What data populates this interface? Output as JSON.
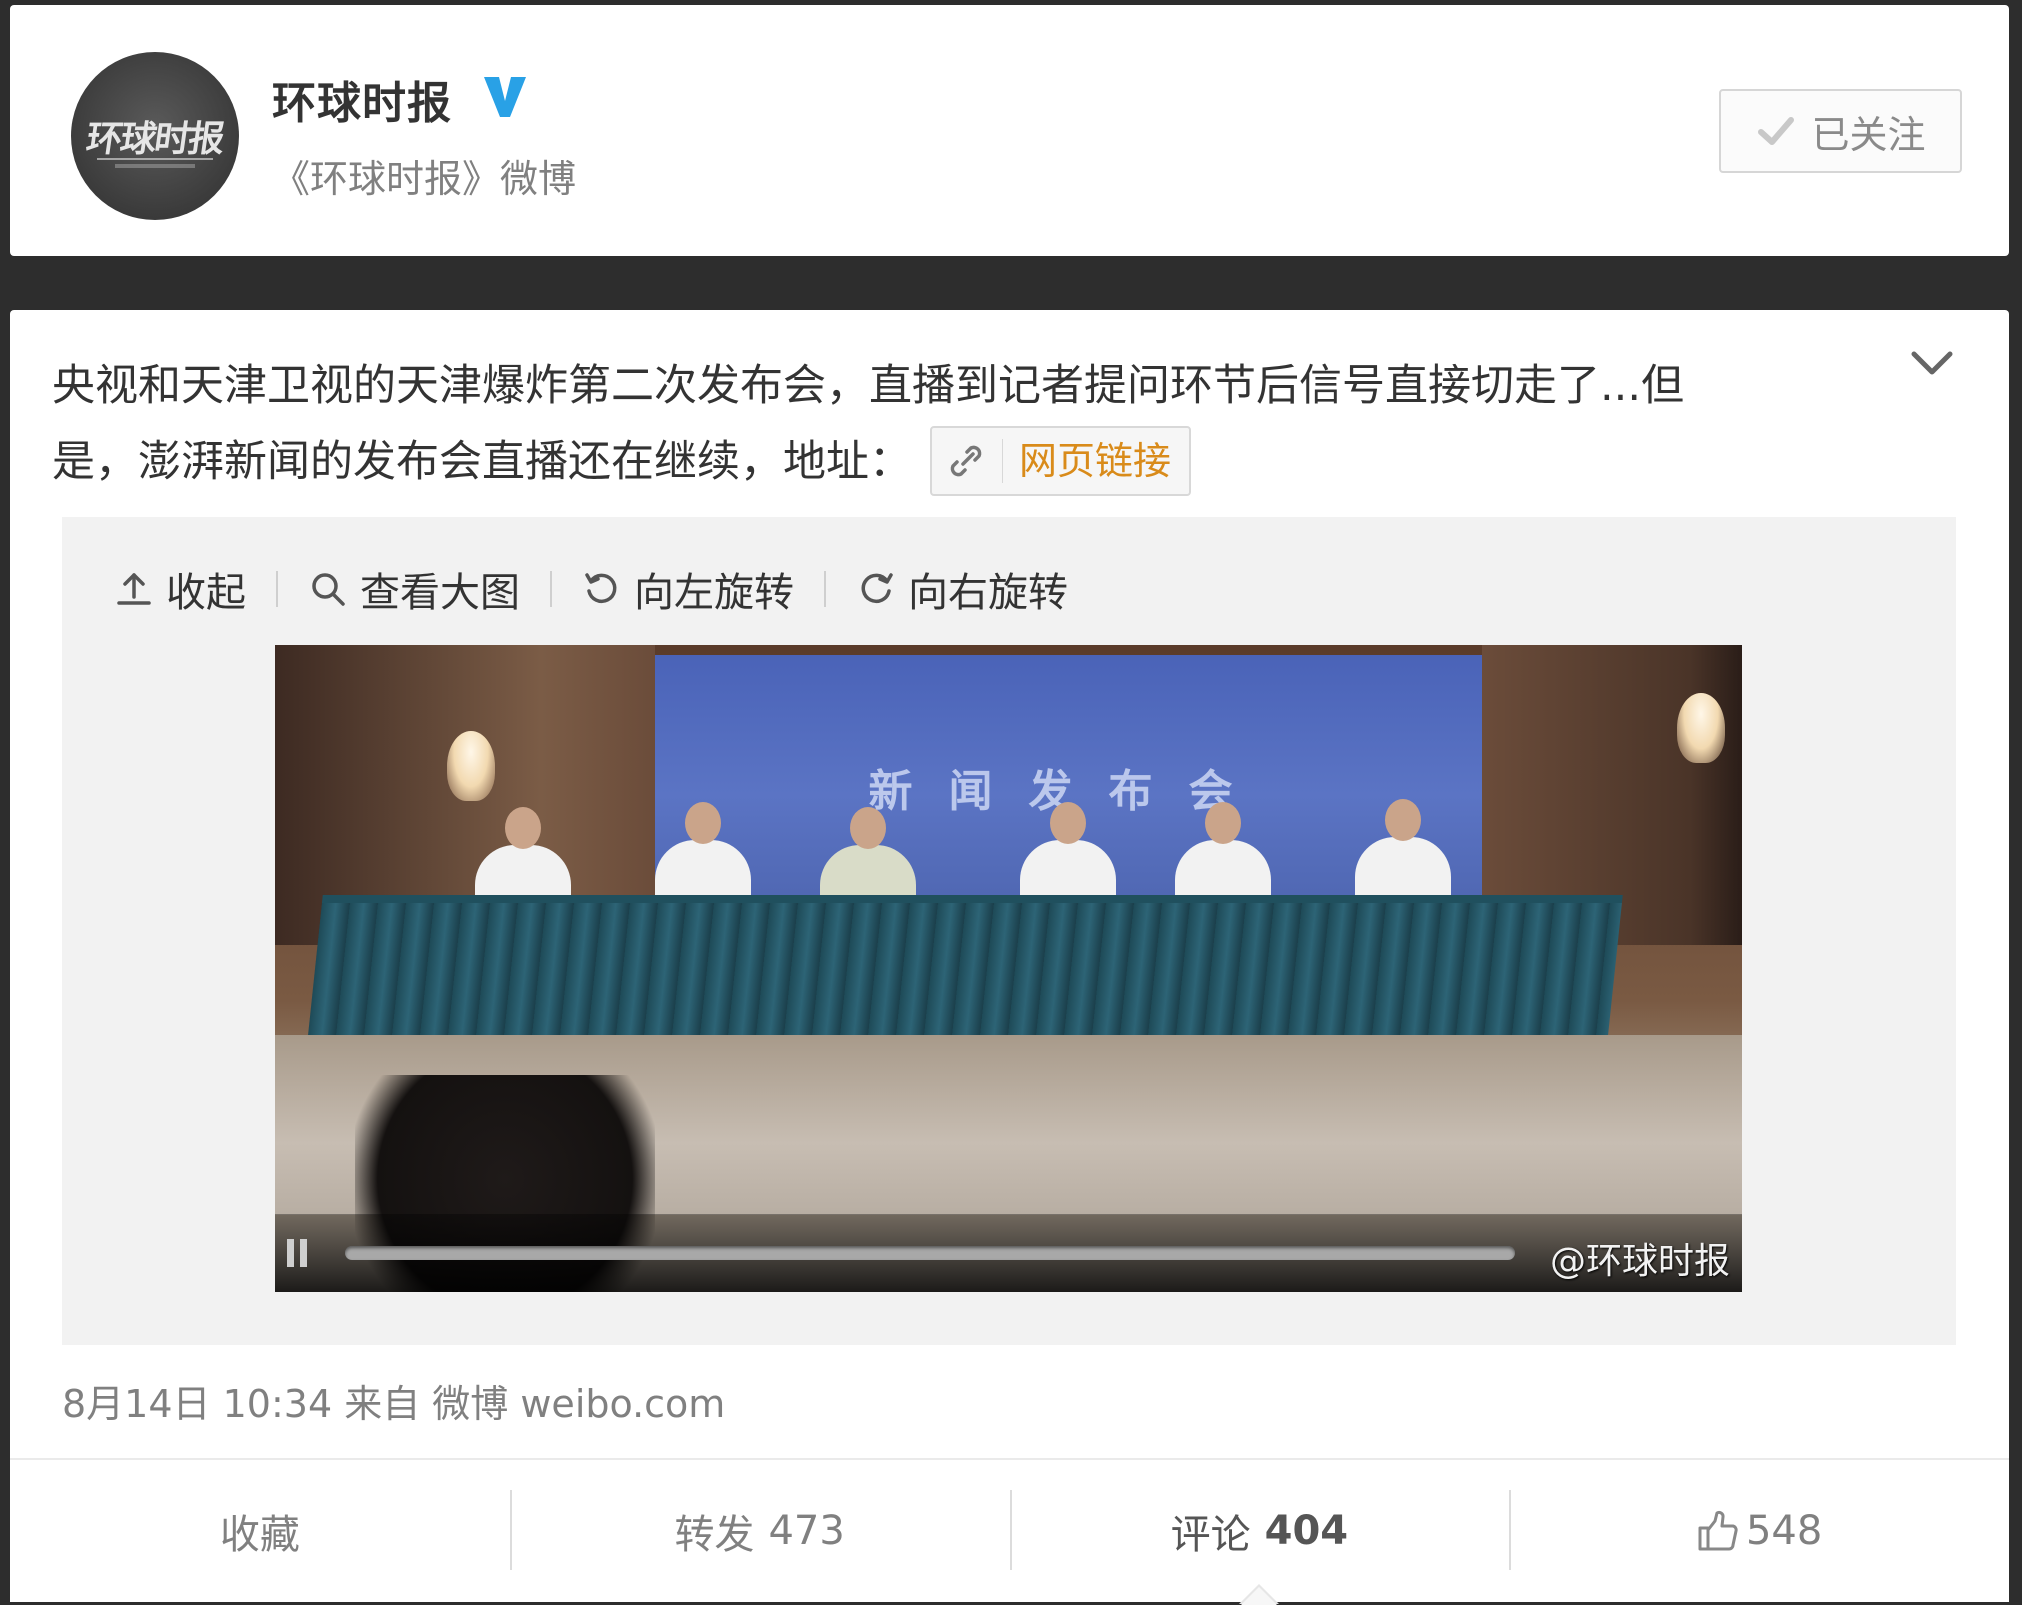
{
  "profile": {
    "name": "环球时报",
    "description": "《环球时报》微博",
    "follow_label": "已关注",
    "avatar_text": "环球时报"
  },
  "post": {
    "text_line1": "央视和天津卫视的天津爆炸第二次发布会，直播到记者提问环节后信号直接切走了...但",
    "text_line2": "是，澎湃新闻的发布会直播还在继续，地址：",
    "link_label": "网页链接",
    "meta": "8月14日 10:34 来自 微博 weibo.com"
  },
  "media_toolbar": {
    "collapse": "收起",
    "view_large": "查看大图",
    "rotate_left": "向左旋转",
    "rotate_right": "向右旋转"
  },
  "video": {
    "backdrop_title": "新闻发布会",
    "watermark": "@环球时报"
  },
  "actions": {
    "favorite": "收藏",
    "repost_label": "转发",
    "repost_count": "473",
    "comment_label": "评论",
    "comment_count": "404",
    "like_count": "548"
  },
  "colors": {
    "background": "#2d2d2d",
    "link": "#d98b1a",
    "verified": "#29a1e6"
  },
  "icons": [
    "verified-icon",
    "check-icon",
    "chevron-down-icon",
    "link-icon",
    "upload-icon",
    "search-icon",
    "rotate-left-icon",
    "rotate-right-icon",
    "pause-icon",
    "thumbs-up-icon"
  ]
}
